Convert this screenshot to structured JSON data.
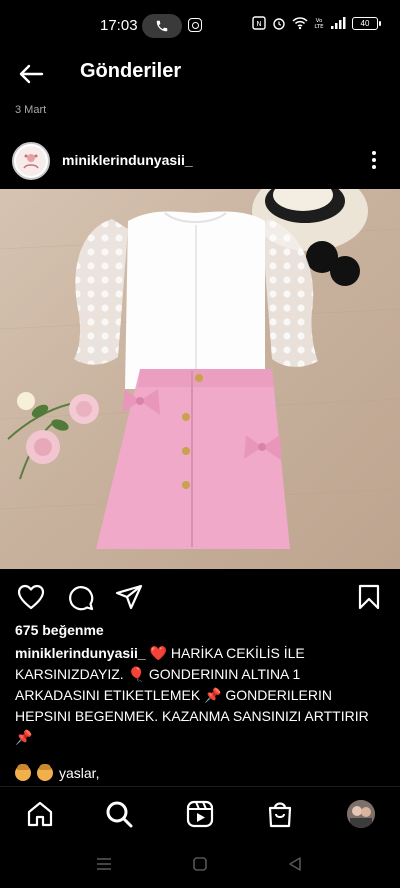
{
  "status_bar": {
    "time": "17:03",
    "battery": "40",
    "icons": [
      "phone-call-icon",
      "instagram-icon",
      "nfc-icon",
      "alarm-icon",
      "wifi-icon",
      "volte-icon",
      "signal-icon",
      "battery-icon"
    ]
  },
  "header": {
    "title": "Gönderiler",
    "back_icon": "back-arrow-icon"
  },
  "post": {
    "date": "3 Mart",
    "username": "miniklerindunyasii_",
    "likes": "675 beğenme",
    "caption_user": "miniklerindunyasii_",
    "caption_text": " ❤️ HARİKA CEKİLİS İLE KARSINIZDAYIZ. 🎈 GONDERININ ALTINA 1 ARKADASINI ETIKETLEMEK 📌 GONDERILERIN HEPSINI BEGENMEK. KAZANMA SANSINIZI ARTTIRIR 📌",
    "comment_preview": "yaslar,"
  },
  "actions": [
    "like-heart-icon",
    "comment-icon",
    "share-icon",
    "save-bookmark-icon"
  ],
  "bottom_nav": [
    "home-icon",
    "search-icon",
    "reels-icon",
    "shop-icon",
    "profile-avatar"
  ],
  "system_nav": [
    "menu-lines-icon",
    "home-square-icon",
    "back-triangle-icon"
  ],
  "colors": {
    "background": "#000000",
    "text": "#ffffff",
    "secondary_text": "#a8a8a8",
    "skirt_pink": "#f0a9c8"
  }
}
